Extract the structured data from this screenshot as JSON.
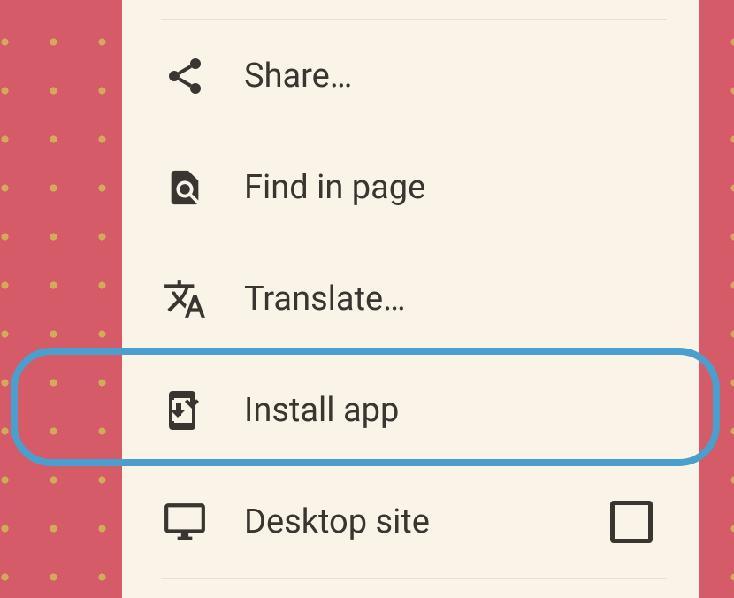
{
  "menu": {
    "items": [
      {
        "label": "Share…",
        "icon": "share-icon"
      },
      {
        "label": "Find in page",
        "icon": "find-in-page-icon"
      },
      {
        "label": "Translate…",
        "icon": "translate-icon"
      },
      {
        "label": "Install app",
        "icon": "install-app-icon",
        "highlighted": true
      },
      {
        "label": "Desktop site",
        "icon": "desktop-icon",
        "hasCheckbox": true,
        "checked": false
      }
    ]
  }
}
